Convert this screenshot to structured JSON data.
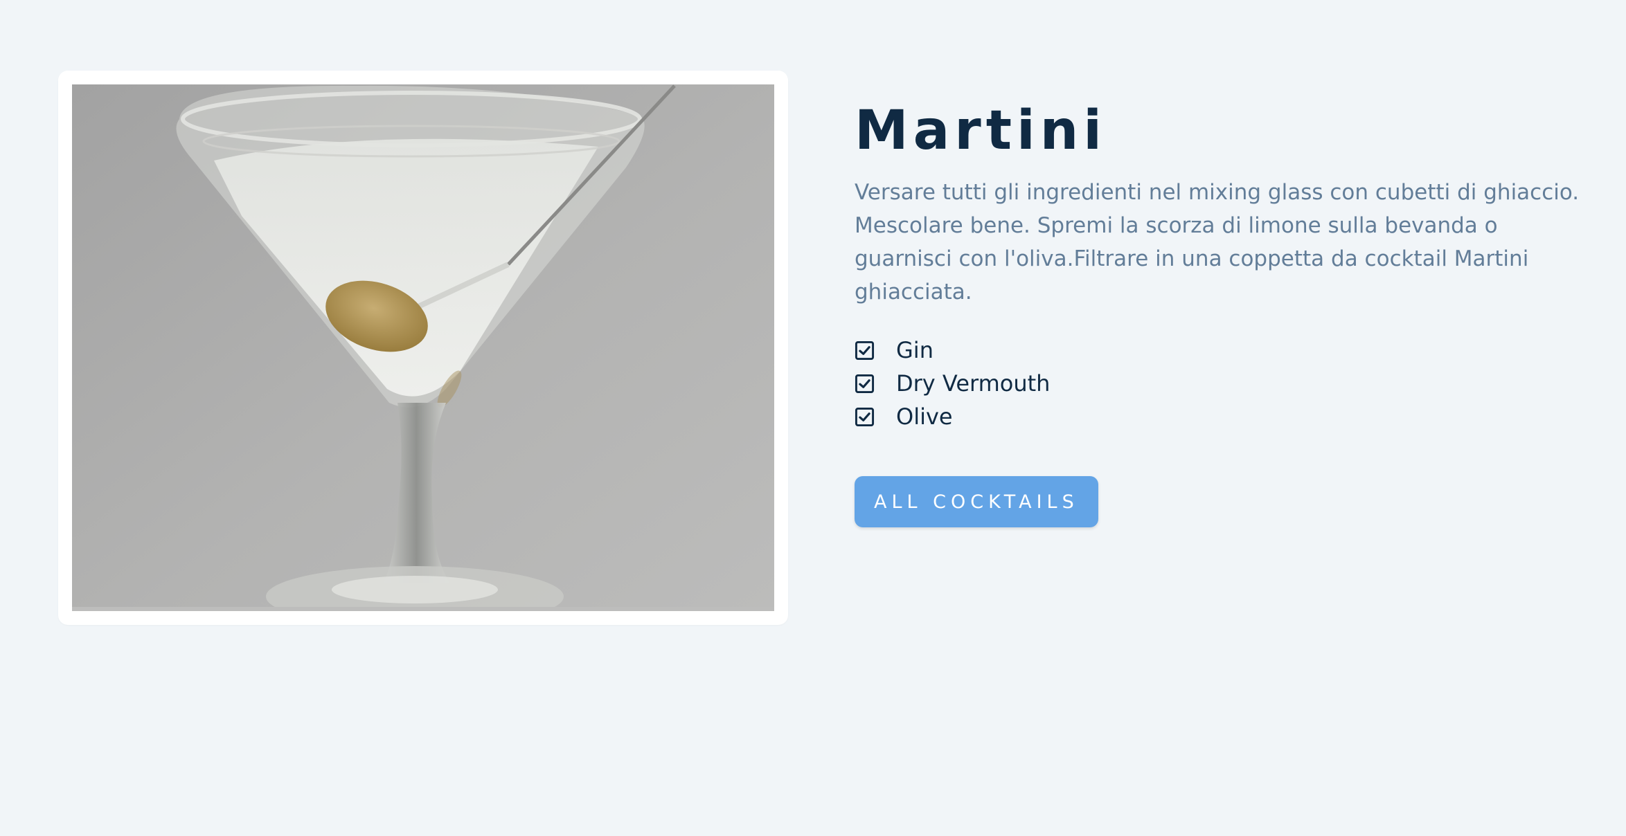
{
  "drink": {
    "name": "Martini",
    "instructions": "Versare tutti gli ingredienti nel mixing glass con cubetti di ghiaccio. Mescolare bene. Spremi la scorza di limone sulla bevanda o guarnisci con l'oliva.Filtrare in una coppetta da cocktail Martini ghiacciata.",
    "ingredients": [
      {
        "label": "Gin",
        "icon": "checkbox-checked-icon"
      },
      {
        "label": "Dry Vermouth",
        "icon": "checkbox-checked-icon"
      },
      {
        "label": "Olive",
        "icon": "checkbox-checked-icon"
      }
    ],
    "image_subject": "martini-glass-with-olive"
  },
  "actions": {
    "all_cocktails_label": "ALL COCKTAILS"
  },
  "colors": {
    "background": "#f1f5f8",
    "title": "#102a43",
    "body_text": "#627d98",
    "button": "#63a4e6",
    "button_text": "#ffffff"
  }
}
